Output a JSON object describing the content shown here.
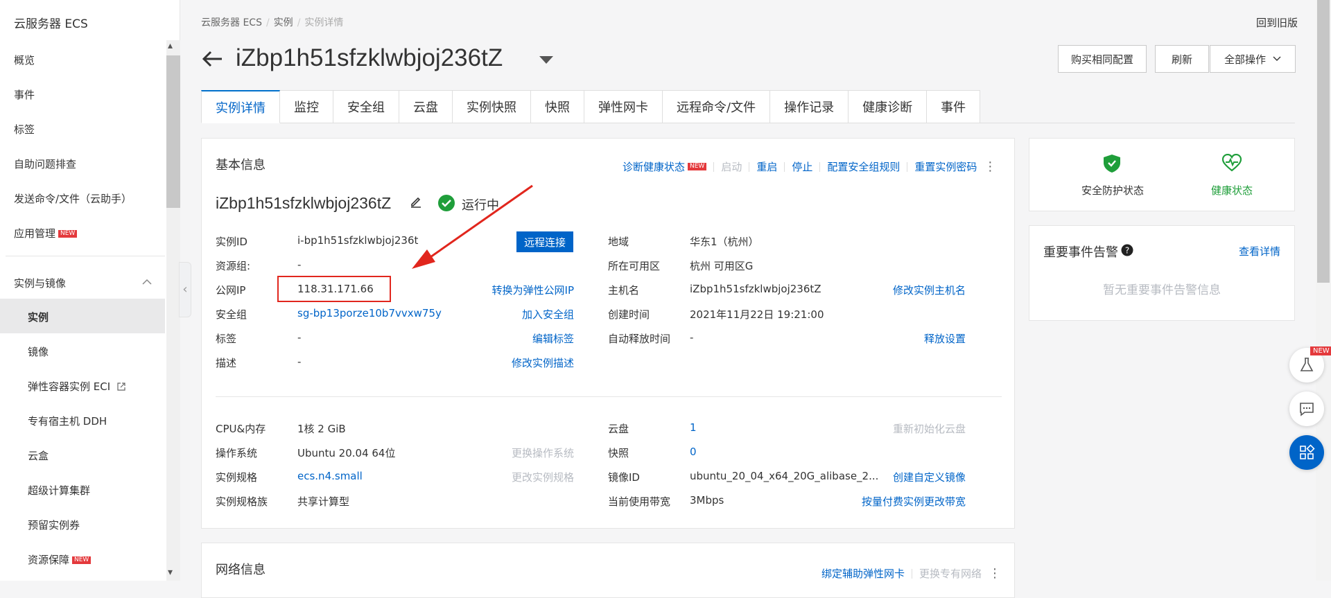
{
  "sidebar": {
    "title": "云服务器 ECS",
    "items": [
      {
        "label": "概览"
      },
      {
        "label": "事件"
      },
      {
        "label": "标签"
      },
      {
        "label": "自助问题排查"
      },
      {
        "label": "发送命令/文件（云助手）"
      },
      {
        "label": "应用管理",
        "badge": "NEW"
      }
    ],
    "group": {
      "label": "实例与镜像"
    },
    "sub_items": [
      {
        "label": "实例",
        "active": true
      },
      {
        "label": "镜像"
      },
      {
        "label": "弹性容器实例 ECI"
      },
      {
        "label": "专有宿主机 DDH"
      },
      {
        "label": "云盒"
      },
      {
        "label": "超级计算集群"
      },
      {
        "label": "预留实例券"
      },
      {
        "label": "资源保障",
        "badge": "NEW"
      }
    ]
  },
  "breadcrumb": {
    "items": [
      "云服务器 ECS",
      "实例",
      "实例详情"
    ]
  },
  "header": {
    "old_version": "回到旧版",
    "title": "iZbp1h51sfzklwbjoj236tZ",
    "buttons": {
      "buy_same": "购买相同配置",
      "refresh": "刷新",
      "all_ops": "全部操作"
    }
  },
  "tabs": [
    {
      "label": "实例详情",
      "active": true
    },
    {
      "label": "监控"
    },
    {
      "label": "安全组"
    },
    {
      "label": "云盘"
    },
    {
      "label": "实例快照"
    },
    {
      "label": "快照"
    },
    {
      "label": "弹性网卡"
    },
    {
      "label": "远程命令/文件"
    },
    {
      "label": "操作记录"
    },
    {
      "label": "健康诊断"
    },
    {
      "label": "事件"
    }
  ],
  "basic": {
    "title": "基本信息",
    "actions": {
      "diagnose": "诊断健康状态",
      "diagnose_badge": "NEW",
      "start": "启动",
      "restart": "重启",
      "stop": "停止",
      "sg_rules": "配置安全组规则",
      "reset_pwd": "重置实例密码"
    },
    "instance_name": "iZbp1h51sfzklwbjoj236tZ",
    "status": "运行中",
    "remote_button": "远程连接",
    "left": [
      {
        "label": "实例ID",
        "value": "i-bp1h51sfzklwbjoj236t",
        "action": ""
      },
      {
        "label": "资源组:",
        "value": "-",
        "action": ""
      },
      {
        "label": "公网IP",
        "value": "118.31.171.66",
        "action": "转换为弹性公网IP"
      },
      {
        "label": "安全组",
        "value": "sg-bp13porze10b7vvxw75y",
        "action": "加入安全组"
      },
      {
        "label": "标签",
        "value": "-",
        "action": "编辑标签"
      },
      {
        "label": "描述",
        "value": "-",
        "action": "修改实例描述"
      }
    ],
    "right": [
      {
        "label": "地域",
        "value": "华东1（杭州）",
        "action": ""
      },
      {
        "label": "所在可用区",
        "value": "杭州 可用区G",
        "action": ""
      },
      {
        "label": "主机名",
        "value": "iZbp1h51sfzklwbjoj236tZ",
        "action": "修改实例主机名"
      },
      {
        "label": "创建时间",
        "value": "2021年11月22日 19:21:00",
        "action": ""
      },
      {
        "label": "自动释放时间",
        "value": "-",
        "action": "释放设置"
      }
    ],
    "left2": [
      {
        "label": "CPU&内存",
        "value": "1核 2 GiB",
        "action": ""
      },
      {
        "label": "操作系统",
        "value": "Ubuntu 20.04 64位",
        "action": "更换操作系统"
      },
      {
        "label": "实例规格",
        "value": "ecs.n4.small",
        "action": "更改实例规格"
      },
      {
        "label": "实例规格族",
        "value": "共享计算型",
        "action": ""
      }
    ],
    "right2": [
      {
        "label": "云盘",
        "value": "1",
        "action": "重新初始化云盘"
      },
      {
        "label": "快照",
        "value": "0",
        "action": ""
      },
      {
        "label": "镜像ID",
        "value": "ubuntu_20_04_x64_20G_alibase_2...",
        "action": "创建自定义镜像"
      },
      {
        "label": "当前使用带宽",
        "value": "3Mbps",
        "action": "按量付费实例更改带宽"
      }
    ]
  },
  "network": {
    "title": "网络信息",
    "actions": {
      "bind_eni": "绑定辅助弹性网卡",
      "change_vpc": "更换专有网络"
    }
  },
  "status_panel": {
    "security": "安全防护状态",
    "health": "健康状态"
  },
  "alert_panel": {
    "title": "重要事件告警",
    "view": "查看详情",
    "empty": "暂无重要事件告警信息"
  },
  "floating": {
    "badge": "NEW"
  },
  "colors": {
    "accent": "#0064c8",
    "danger": "#e1261d",
    "success": "#1f9e3a"
  }
}
